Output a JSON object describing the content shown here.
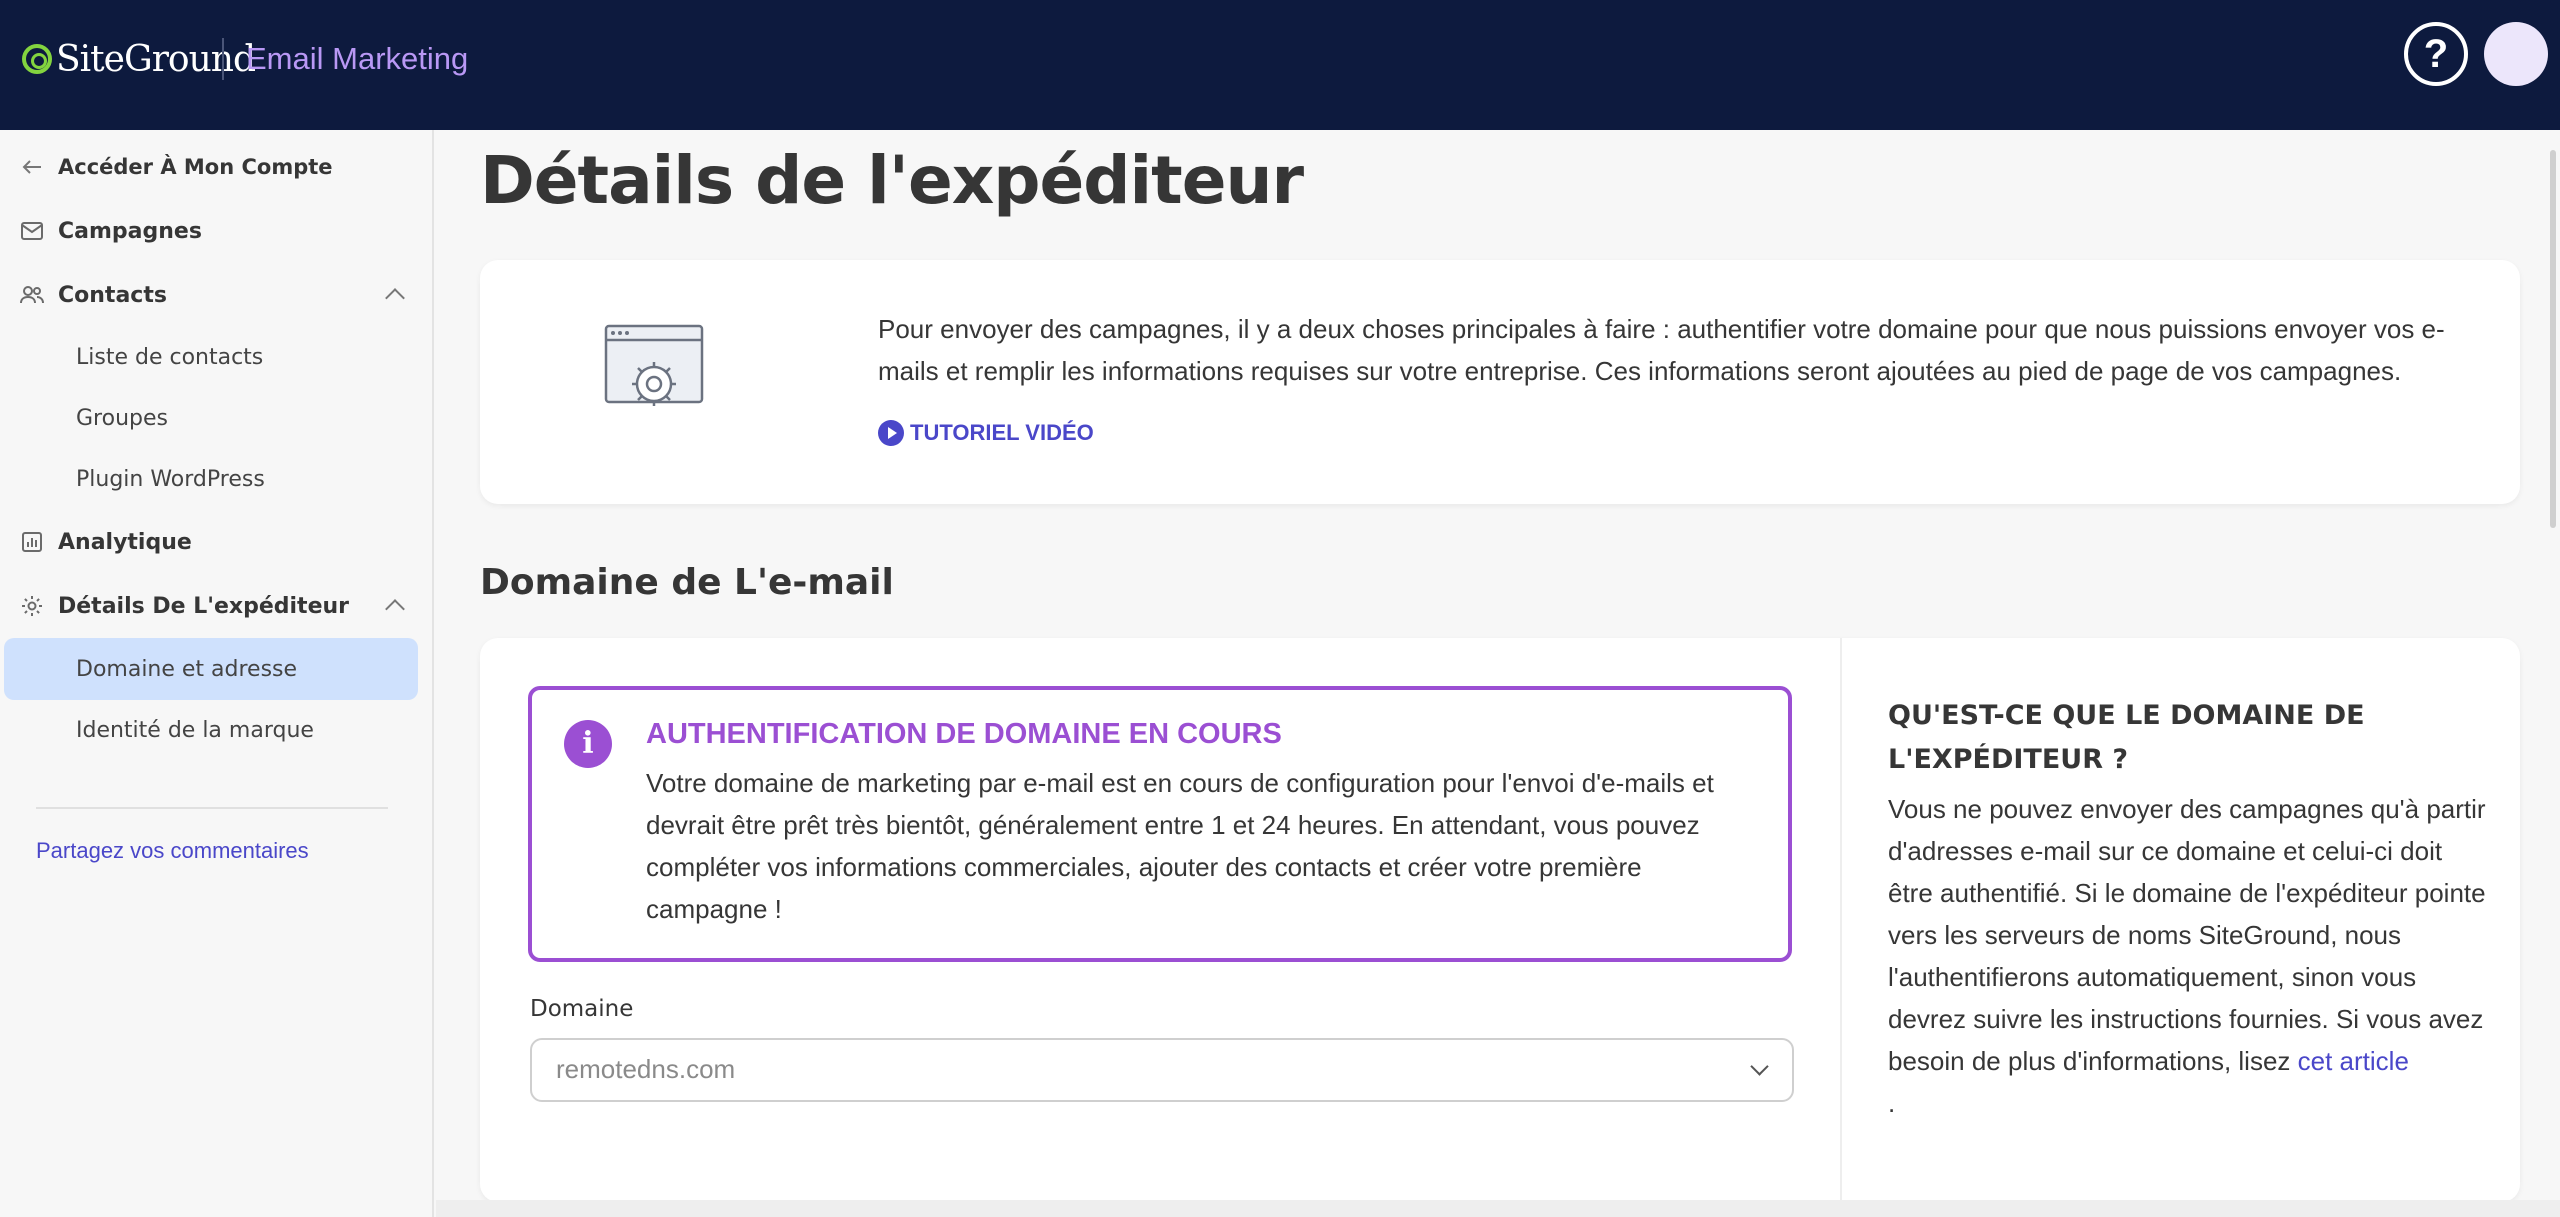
{
  "header": {
    "logo_text": "SiteGround",
    "product_name": "Email Marketing",
    "help_label": "?"
  },
  "sidebar": {
    "back_label": "Accéder À Mon Compte",
    "items": [
      {
        "label": "Campagnes",
        "icon": "envelope-icon"
      },
      {
        "label": "Contacts",
        "icon": "users-icon"
      },
      {
        "label": "Analytique",
        "icon": "chart-icon"
      },
      {
        "label": "Détails De L'expéditeur",
        "icon": "gear-icon"
      }
    ],
    "contacts_sub": [
      "Liste de contacts",
      "Groupes",
      "Plugin WordPress"
    ],
    "sender_sub": [
      "Domaine et adresse",
      "Identité de la marque"
    ],
    "active_item": "Domaine et adresse",
    "feedback": "Partagez vos commentaires"
  },
  "main": {
    "title": "Détails de l'expéditeur",
    "intro": {
      "text": "Pour envoyer des campagnes, il y a deux choses principales à faire : authentifier votre domaine pour que nous puissions envoyer vos e-mails et remplir les informations requises sur votre entreprise. Ces informations seront ajoutées au pied de page de vos campagnes.",
      "tutorial_label": "TUTORIEL VIDÉO"
    },
    "section_title": "Domaine de L'e-mail",
    "alert": {
      "title": "AUTHENTIFICATION DE DOMAINE EN COURS",
      "body": "Votre domaine de marketing par e-mail est en cours de configuration pour l'envoi d'e-mails et devrait être prêt très bientôt, généralement entre 1 et 24 heures. En attendant, vous pouvez compléter vos informations commerciales, ajouter des contacts et créer votre première campagne !"
    },
    "domain_field": {
      "label": "Domaine",
      "value": "remotedns.com"
    },
    "info": {
      "title": "QU'EST-CE QUE LE DOMAINE DE L'EXPÉDITEUR ?",
      "body": "Vous ne pouvez envoyer des campagnes qu'à partir d'adresses e-mail sur ce domaine et celui-ci doit être authentifié. Si le domaine de l'expéditeur pointe vers les serveurs de noms SiteGround, nous l'authentifierons automatiquement, sinon vous devrez suivre les instructions fournies. Si vous avez besoin de plus d'informations, lisez",
      "link": "cet article",
      "trailing": "."
    }
  },
  "colors": {
    "topbar": "#0d1a3e",
    "brand_purple": "#9b4fd3",
    "link_blue": "#4a47c9",
    "active_bg": "#cfe1fd"
  }
}
